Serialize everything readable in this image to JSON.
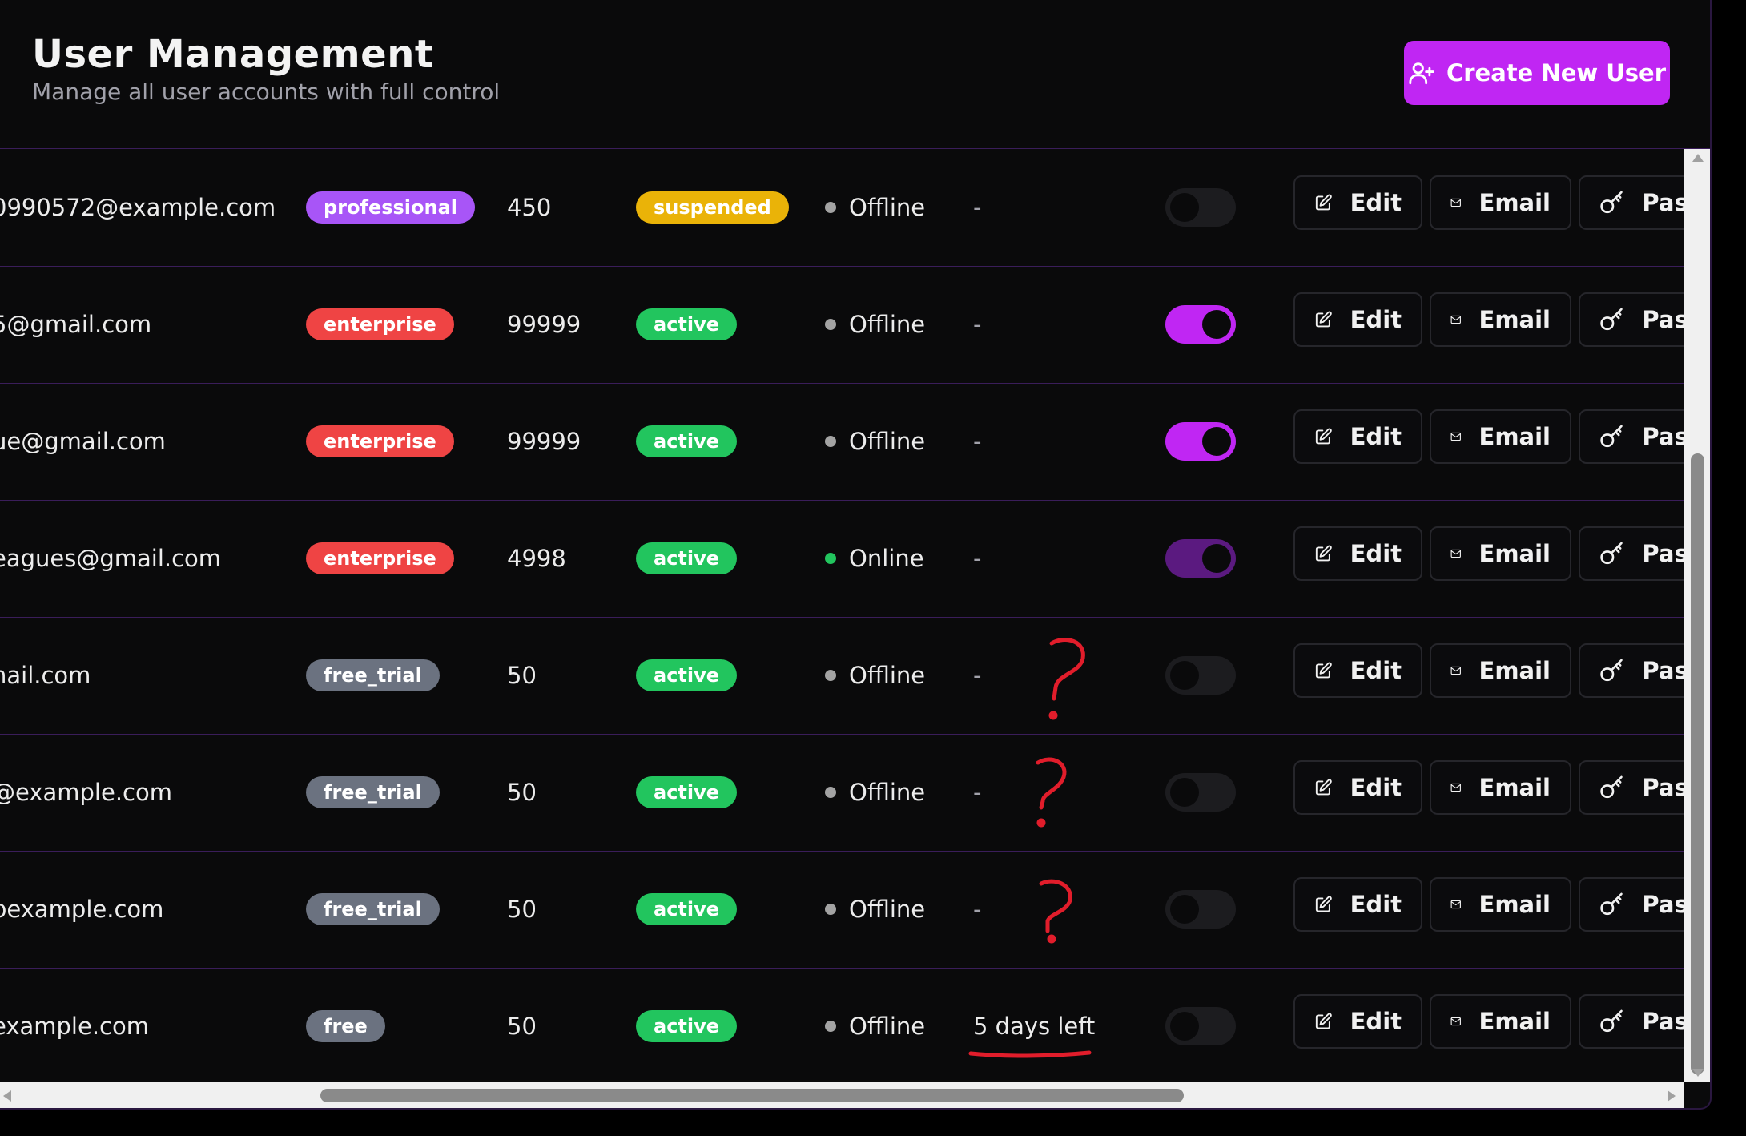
{
  "header": {
    "title": "User Management",
    "subtitle": "Manage all user accounts with full control",
    "create_button_label": "Create New User",
    "create_button_icon": "user-plus-icon"
  },
  "colors": {
    "accent": "#c026f3",
    "plan_professional": "#a855f7",
    "plan_enterprise": "#ef4444",
    "plan_free_trial": "#6b7280",
    "plan_free": "#6b7280",
    "status_active": "#22c55e",
    "status_suspended": "#eab308",
    "presence_online": "#22c55e",
    "presence_offline": "#a3a3a3",
    "annotation": "#e11d2b"
  },
  "actions": {
    "edit_label": "Edit",
    "email_label": "Email",
    "password_label": "Pass"
  },
  "rows": [
    {
      "email": "0990572@example.com",
      "plan": "professional",
      "credits": "450",
      "status": "suspended",
      "presence": "Offline",
      "trial": "-",
      "toggle": "off"
    },
    {
      "email": "5@gmail.com",
      "plan": "enterprise",
      "credits": "99999",
      "status": "active",
      "presence": "Offline",
      "trial": "-",
      "toggle": "on"
    },
    {
      "email": "ue@gmail.com",
      "plan": "enterprise",
      "credits": "99999",
      "status": "active",
      "presence": "Offline",
      "trial": "-",
      "toggle": "on"
    },
    {
      "email": "eagues@gmail.com",
      "plan": "enterprise",
      "credits": "4998",
      "status": "active",
      "presence": "Online",
      "trial": "-",
      "toggle": "on-dim"
    },
    {
      "email": "nail.com",
      "plan": "free_trial",
      "credits": "50",
      "status": "active",
      "presence": "Offline",
      "trial": "-",
      "toggle": "off"
    },
    {
      "email": "@example.com",
      "plan": "free_trial",
      "credits": "50",
      "status": "active",
      "presence": "Offline",
      "trial": "-",
      "toggle": "off"
    },
    {
      "email": "pexample.com",
      "plan": "free_trial",
      "credits": "50",
      "status": "active",
      "presence": "Offline",
      "trial": "-",
      "toggle": "off"
    },
    {
      "email": "example.com",
      "plan": "free",
      "credits": "50",
      "status": "active",
      "presence": "Offline",
      "trial": "5 days left",
      "toggle": "off"
    }
  ],
  "annotations": {
    "question_mark": "?"
  }
}
